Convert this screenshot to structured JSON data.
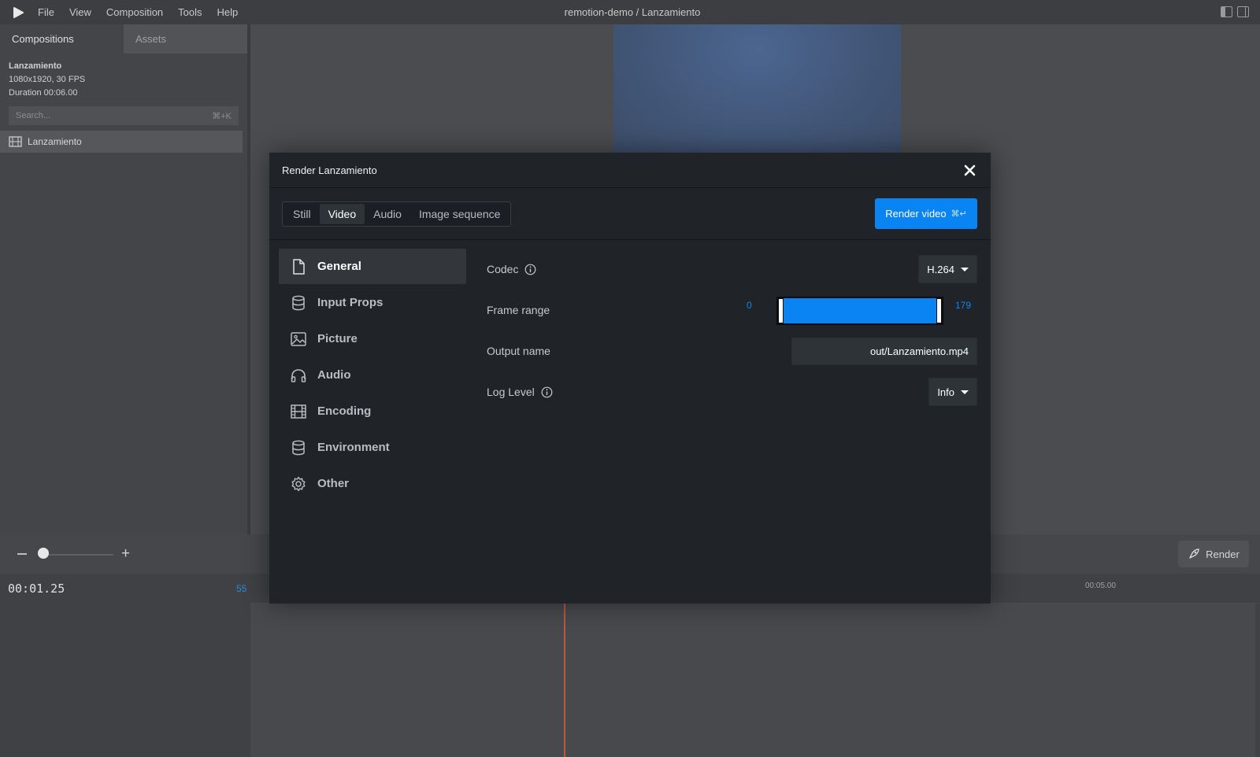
{
  "menubar": {
    "items": [
      "File",
      "View",
      "Composition",
      "Tools",
      "Help"
    ],
    "title": "remotion-demo / Lanzamiento"
  },
  "sidebar": {
    "tabs": [
      "Compositions",
      "Assets"
    ],
    "composition": {
      "name": "Lanzamiento",
      "dims": "1080x1920, 30 FPS",
      "duration": "Duration 00:06.00"
    },
    "search_placeholder": "Search...",
    "search_shortcut": "⌘+K",
    "list": [
      {
        "label": "Lanzamiento"
      }
    ]
  },
  "bottom": {
    "render_label": "Render",
    "timecode": "00:01.25",
    "frame": "55",
    "ruler_label": "00:05.00"
  },
  "modal": {
    "title": "Render Lanzamiento",
    "tabs": [
      "Still",
      "Video",
      "Audio",
      "Image sequence"
    ],
    "active_tab": "Video",
    "render_button": "Render video",
    "render_shortcut": "⌘↵",
    "nav": [
      {
        "label": "General",
        "icon": "file-icon"
      },
      {
        "label": "Input Props",
        "icon": "database-icon"
      },
      {
        "label": "Picture",
        "icon": "image-icon"
      },
      {
        "label": "Audio",
        "icon": "headphones-icon"
      },
      {
        "label": "Encoding",
        "icon": "film-icon"
      },
      {
        "label": "Environment",
        "icon": "database-icon"
      },
      {
        "label": "Other",
        "icon": "gear-icon"
      }
    ],
    "active_nav": "General",
    "settings": {
      "codec_label": "Codec",
      "codec_value": "H.264",
      "frame_range_label": "Frame range",
      "frame_start": "0",
      "frame_end": "179",
      "output_label": "Output name",
      "output_value": "out/Lanzamiento.mp4",
      "log_label": "Log Level",
      "log_value": "Info"
    }
  },
  "colors": {
    "accent": "#0b84f3",
    "modal_bg": "#202428",
    "playhead": "#b85a3c"
  }
}
